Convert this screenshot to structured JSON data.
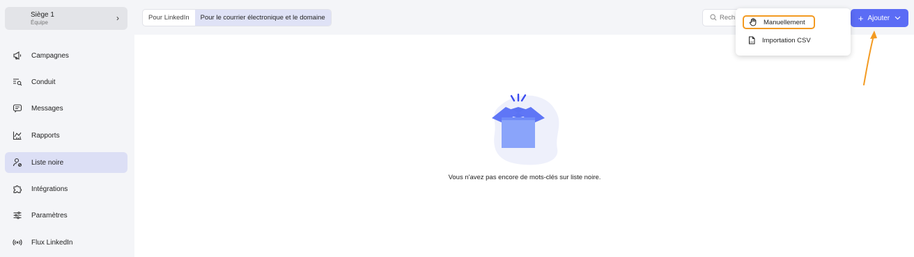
{
  "sidebar": {
    "workspace": {
      "name": "Siège 1",
      "subtitle": "Équipe",
      "chevron": "›"
    },
    "items": [
      {
        "label": "Campagnes",
        "icon": "megaphone-icon"
      },
      {
        "label": "Conduit",
        "icon": "list-search-icon"
      },
      {
        "label": "Messages",
        "icon": "message-icon"
      },
      {
        "label": "Rapports",
        "icon": "chart-icon"
      },
      {
        "label": "Liste noire",
        "icon": "user-block-icon",
        "active": true
      },
      {
        "label": "Intégrations",
        "icon": "puzzle-icon"
      },
      {
        "label": "Paramètres",
        "icon": "sliders-icon"
      },
      {
        "label": "Flux LinkedIn",
        "icon": "broadcast-icon"
      }
    ]
  },
  "tabs": [
    {
      "label": "Pour LinkedIn",
      "active": false
    },
    {
      "label": "Pour le courrier électronique et le domaine",
      "active": true
    }
  ],
  "search": {
    "placeholder": "Rech"
  },
  "add_button": {
    "label": "Ajouter",
    "plus": "+",
    "caret": "⌄"
  },
  "dropdown": {
    "items": [
      {
        "label": "Manuellement",
        "icon": "hand-icon",
        "highlighted": true
      },
      {
        "label": "Importation CSV",
        "icon": "csv-file-icon"
      }
    ]
  },
  "empty_state": {
    "message": "Vous n'avez pas encore de mots-clés sur liste noire."
  },
  "colors": {
    "accent": "#5b6cf5",
    "active_bg": "#dcdff5",
    "highlight": "#f39a21",
    "illustration": "#7f9cf8"
  }
}
